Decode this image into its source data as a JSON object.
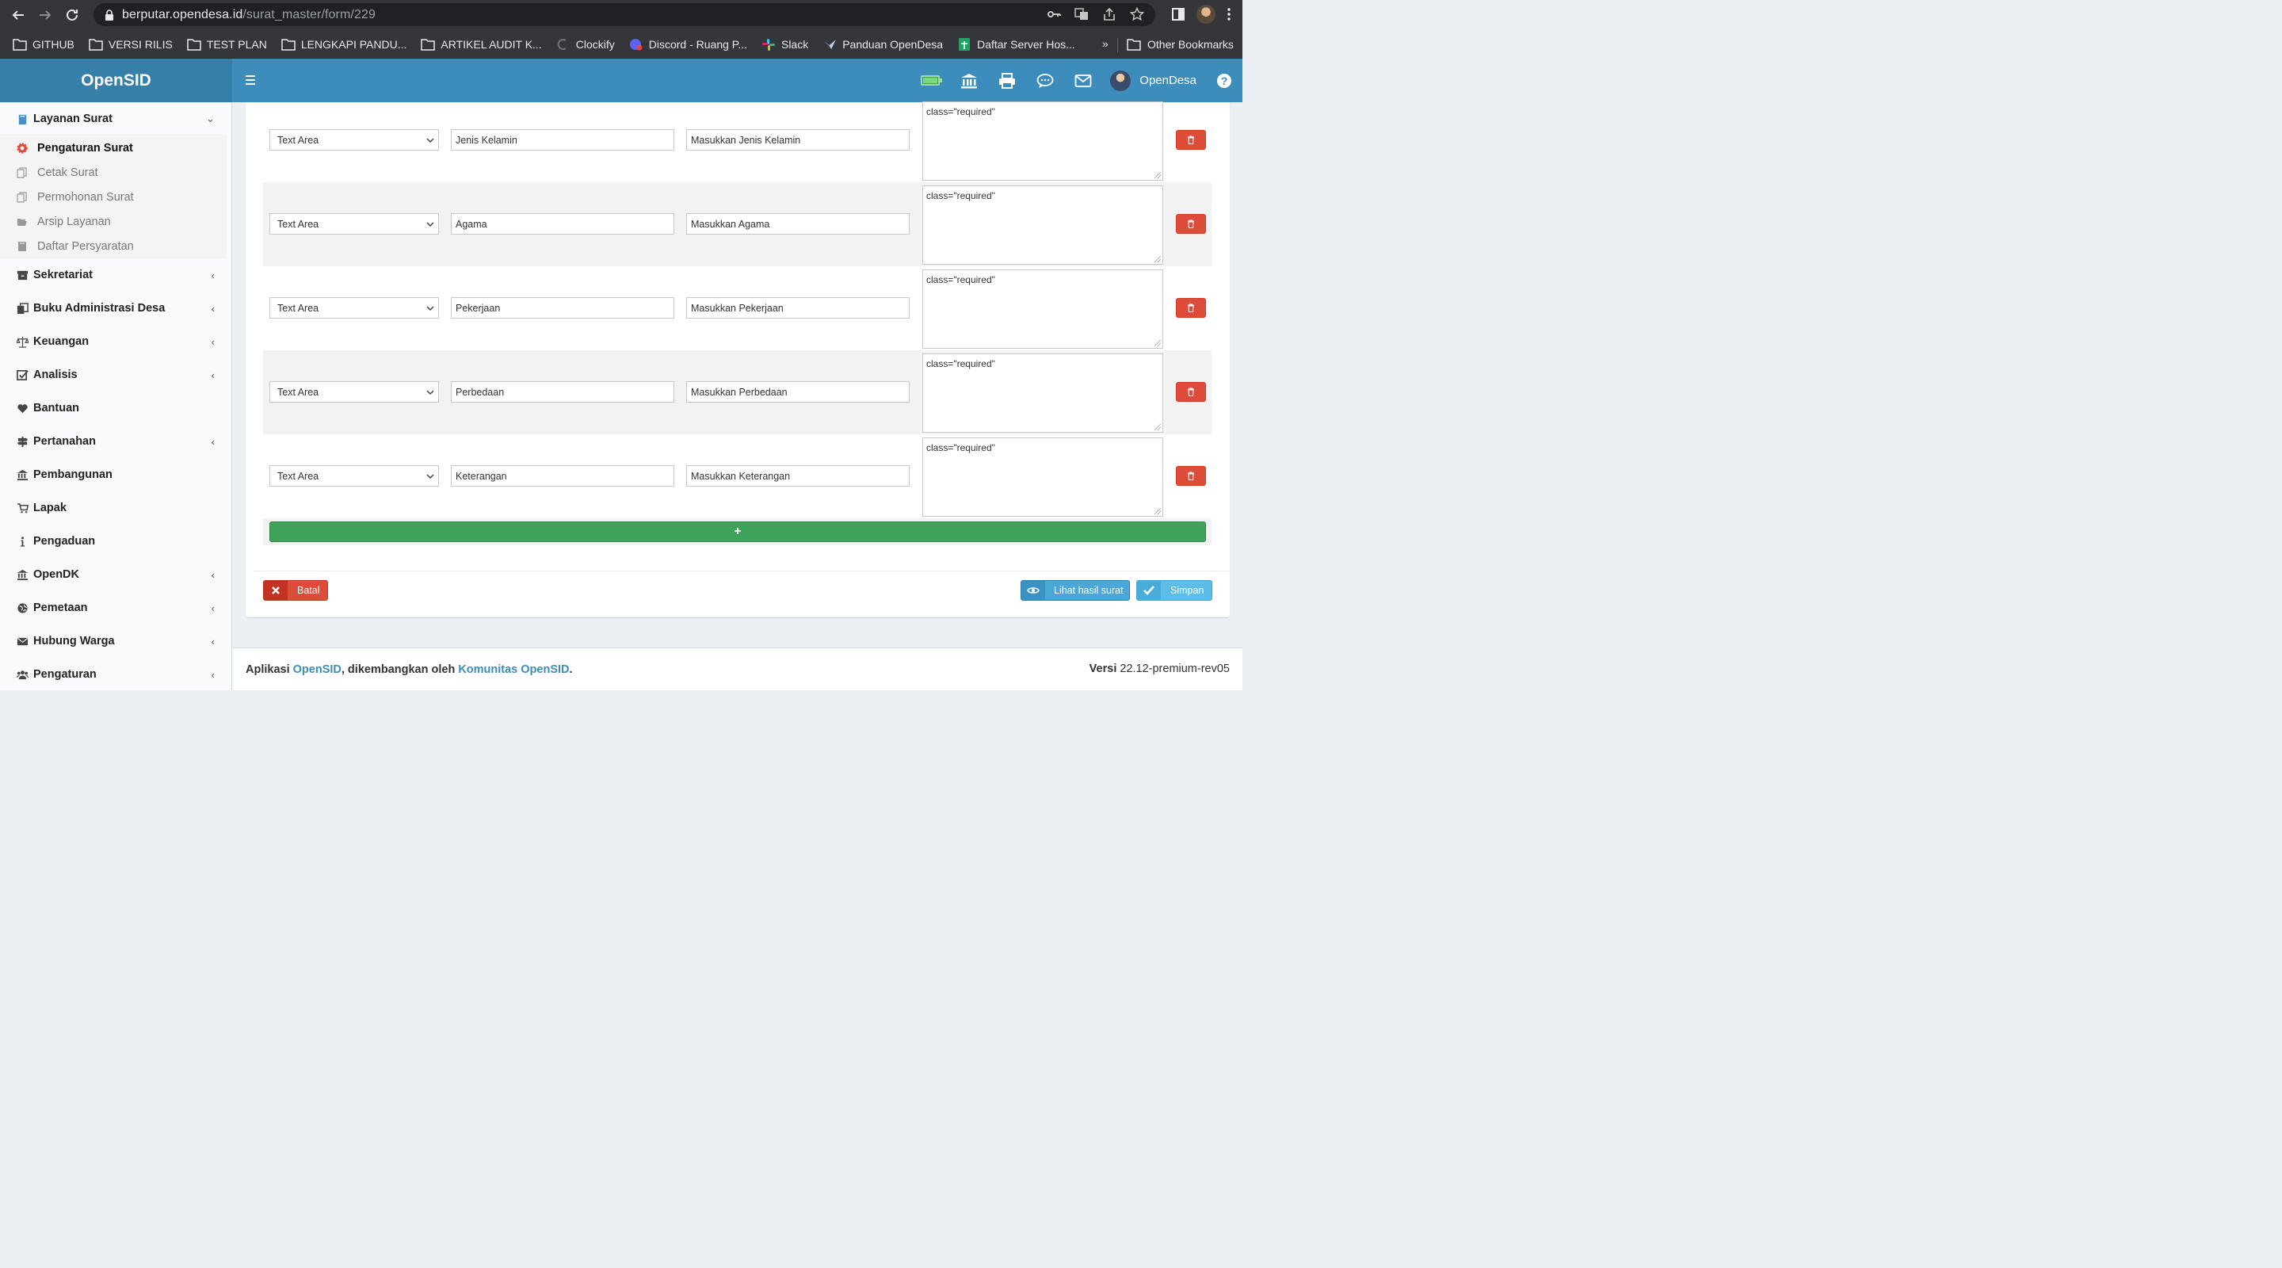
{
  "browser": {
    "url_host": "berputar.opendesa.id",
    "url_path": "/surat_master/form/229",
    "bookmarks": [
      {
        "label": "GITHUB",
        "icon": "folder-icon"
      },
      {
        "label": "VERSI RILIS",
        "icon": "folder-icon"
      },
      {
        "label": "TEST PLAN",
        "icon": "folder-icon"
      },
      {
        "label": "LENGKAPI PANDU...",
        "icon": "folder-icon"
      },
      {
        "label": "ARTIKEL AUDIT K...",
        "icon": "folder-icon"
      },
      {
        "label": "Clockify",
        "icon": "clockify-icon"
      },
      {
        "label": "Discord - Ruang P...",
        "icon": "discord-icon"
      },
      {
        "label": "Slack",
        "icon": "slack-icon"
      },
      {
        "label": "Panduan OpenDesa",
        "icon": "opendesa-icon"
      },
      {
        "label": "Daftar Server Hos...",
        "icon": "sheets-icon"
      }
    ],
    "more_label": "»",
    "other_bookmarks": "Other Bookmarks"
  },
  "header": {
    "app_name": "OpenSID",
    "user_name": "OpenDesa",
    "help_label": "?"
  },
  "sidebar": {
    "open_section": "Layanan Surat",
    "sub_items": [
      {
        "label": "Pengaturan Surat",
        "icon": "gear-icon",
        "active": true
      },
      {
        "label": "Cetak Surat",
        "icon": "files-icon"
      },
      {
        "label": "Permohonan Surat",
        "icon": "files-icon"
      },
      {
        "label": "Arsip Layanan",
        "icon": "folder-open-icon"
      },
      {
        "label": "Daftar Persyaratan",
        "icon": "book-icon"
      }
    ],
    "items": [
      {
        "label": "Sekretariat",
        "icon": "archive-icon",
        "has_children": true
      },
      {
        "label": "Buku Administrasi Desa",
        "icon": "copy-icon",
        "has_children": true
      },
      {
        "label": "Keuangan",
        "icon": "scale-icon",
        "has_children": true
      },
      {
        "label": "Analisis",
        "icon": "check-square-icon",
        "has_children": true
      },
      {
        "label": "Bantuan",
        "icon": "heart-icon",
        "has_children": false
      },
      {
        "label": "Pertanahan",
        "icon": "signpost-icon",
        "has_children": true
      },
      {
        "label": "Pembangunan",
        "icon": "bank-icon",
        "has_children": false
      },
      {
        "label": "Lapak",
        "icon": "cart-icon",
        "has_children": false
      },
      {
        "label": "Pengaduan",
        "icon": "info-icon",
        "has_children": false
      },
      {
        "label": "OpenDK",
        "icon": "bank-icon",
        "has_children": true
      },
      {
        "label": "Pemetaan",
        "icon": "globe-icon",
        "has_children": true
      },
      {
        "label": "Hubung Warga",
        "icon": "envelope-icon",
        "has_children": true
      },
      {
        "label": "Pengaturan",
        "icon": "users-icon",
        "has_children": true
      }
    ]
  },
  "form": {
    "rows": [
      {
        "type": "Text Area",
        "label": "Jenis Kelamin",
        "placeholder": "Masukkan Jenis Kelamin",
        "attribute": "class=\"required\""
      },
      {
        "type": "Text Area",
        "label": "Agama",
        "placeholder": "Masukkan Agama",
        "attribute": "class=\"required\""
      },
      {
        "type": "Text Area",
        "label": "Pekerjaan",
        "placeholder": "Masukkan Pekerjaan",
        "attribute": "class=\"required\""
      },
      {
        "type": "Text Area",
        "label": "Perbedaan",
        "placeholder": "Masukkan Perbedaan",
        "attribute": "class=\"required\""
      },
      {
        "type": "Text Area",
        "label": "Keterangan",
        "placeholder": "Masukkan Keterangan",
        "attribute": "class=\"required\""
      }
    ],
    "add_label": "+",
    "buttons": {
      "batal": "Batal",
      "lihat": "Lihat hasil surat",
      "simpan": "Simpan"
    }
  },
  "footer": {
    "prefix": "Aplikasi ",
    "app_link": "OpenSID",
    "middle": ", dikembangkan oleh ",
    "community_link": "Komunitas OpenSID",
    "suffix": ".",
    "version_label": "Versi",
    "version_value": "22.12-premium-rev05"
  },
  "colors": {
    "header_blue": "#3c8dbc",
    "danger": "#dd4b39",
    "success": "#3ea25a",
    "info": "#5cbde8"
  }
}
